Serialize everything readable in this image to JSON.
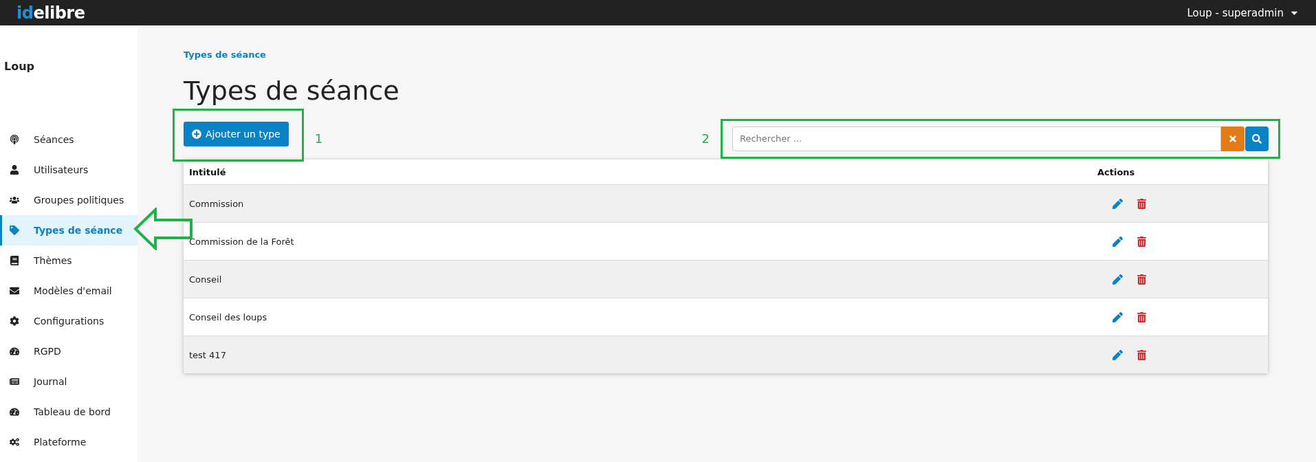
{
  "topbar": {
    "logo_accent": "id",
    "logo_rest": "elibre",
    "user_menu": "Loup - superadmin"
  },
  "sidebar": {
    "title": "Loup",
    "items": [
      {
        "label": "Séances",
        "selected": false
      },
      {
        "label": "Utilisateurs",
        "selected": false
      },
      {
        "label": "Groupes politiques",
        "selected": false
      },
      {
        "label": "Types de séance",
        "selected": true
      },
      {
        "label": "Thèmes",
        "selected": false
      },
      {
        "label": "Modèles d'email",
        "selected": false
      },
      {
        "label": "Configurations",
        "selected": false
      },
      {
        "label": "RGPD",
        "selected": false
      },
      {
        "label": "Journal",
        "selected": false
      },
      {
        "label": "Tableau de bord",
        "selected": false
      },
      {
        "label": "Plateforme",
        "selected": false
      }
    ]
  },
  "breadcrumb": "Types de séance",
  "page_title": "Types de séance",
  "add_button": "Ajouter un type",
  "search": {
    "placeholder": "Rechercher ..."
  },
  "annotations": [
    "1",
    "2"
  ],
  "table": {
    "columns": [
      "Intitulé",
      "Actions"
    ],
    "rows": [
      {
        "name": "Commission"
      },
      {
        "name": "Commission de la Forêt"
      },
      {
        "name": "Conseil"
      },
      {
        "name": "Conseil des loups"
      },
      {
        "name": "test 417"
      }
    ]
  }
}
